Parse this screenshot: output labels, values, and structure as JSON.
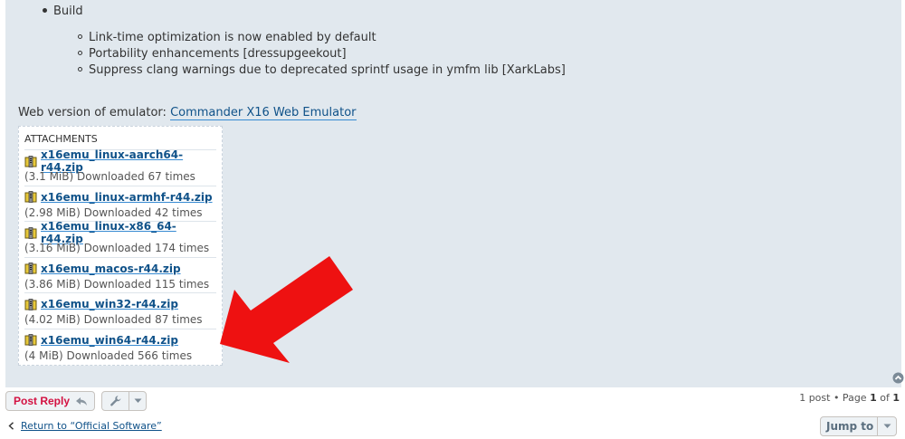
{
  "post": {
    "build_heading": "Build",
    "build_items": [
      "Link-time optimization is now enabled by default",
      "Portability enhancements [dressupgeekout]",
      "Suppress clang warnings due to deprecated sprintf usage in ymfm lib [XarkLabs]"
    ],
    "web_prefix": "Web version of emulator:",
    "web_link": "Commander X16 Web Emulator"
  },
  "attachments": {
    "title": "ATTACHMENTS",
    "files": [
      {
        "name": "x16emu_linux-aarch64-r44.zip",
        "meta": "(3.1 MiB) Downloaded 67 times"
      },
      {
        "name": "x16emu_linux-armhf-r44.zip",
        "meta": "(2.98 MiB) Downloaded 42 times"
      },
      {
        "name": "x16emu_linux-x86_64-r44.zip",
        "meta": "(3.16 MiB) Downloaded 174 times"
      },
      {
        "name": "x16emu_macos-r44.zip",
        "meta": "(3.86 MiB) Downloaded 115 times"
      },
      {
        "name": "x16emu_win32-r44.zip",
        "meta": "(4.02 MiB) Downloaded 87 times"
      },
      {
        "name": "x16emu_win64-r44.zip",
        "meta": "(4 MiB) Downloaded 566 times"
      }
    ]
  },
  "actions": {
    "post_reply": "Post Reply",
    "pagination_prefix": "1 post • Page",
    "page_current": "1",
    "page_of": "of",
    "page_total": "1",
    "return_link": "Return to “Official Software”",
    "jump_to": "Jump to"
  },
  "colors": {
    "panel_bg": "#e1e8ee",
    "link": "#105289",
    "reply_red": "#d31141",
    "arrow_red": "#ee1111"
  },
  "icons": {
    "attachment": "zip-file-icon",
    "reply": "reply-arrow-icon",
    "tools": "wrench-icon",
    "top": "back-to-top-icon",
    "return": "chevron-left-icon",
    "dropdown": "caret-down-icon"
  }
}
